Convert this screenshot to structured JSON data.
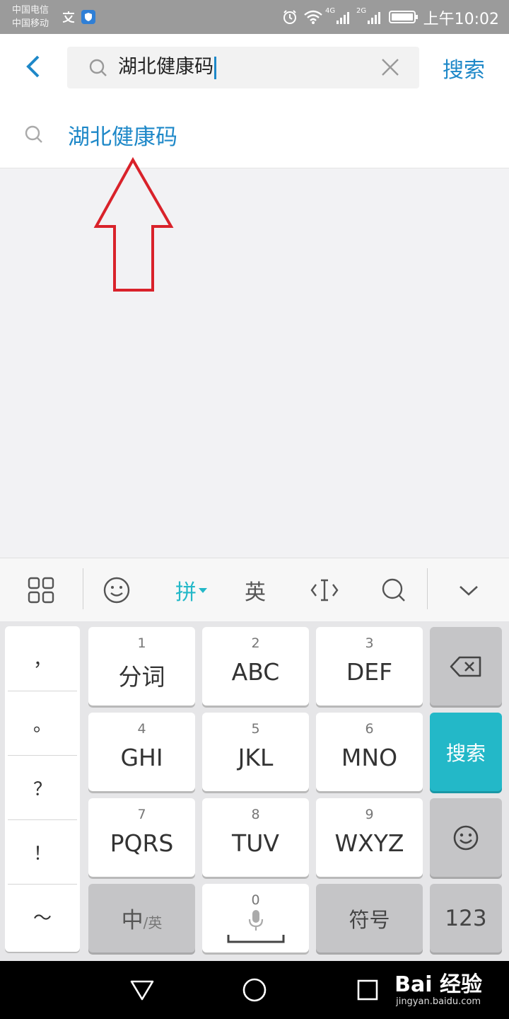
{
  "status_bar": {
    "carrier1": "中国电信",
    "carrier2": "中国移动",
    "badge1": "4G",
    "badge2": "2G",
    "time": "上午10:02"
  },
  "search": {
    "query": "湖北健康码",
    "search_button": "搜索"
  },
  "suggestions": [
    {
      "text": "湖北健康码"
    }
  ],
  "keyboard": {
    "toolbar": {
      "pinyin": "拼",
      "english": "英"
    },
    "punctuation": [
      "，",
      "。",
      "？",
      "！",
      "～"
    ],
    "keys": {
      "k1": {
        "num": "1",
        "label": "分词"
      },
      "k2": {
        "num": "2",
        "label": "ABC"
      },
      "k3": {
        "num": "3",
        "label": "DEF"
      },
      "k4": {
        "num": "4",
        "label": "GHI"
      },
      "k5": {
        "num": "5",
        "label": "JKL"
      },
      "k6": {
        "num": "6",
        "label": "MNO"
      },
      "k7": {
        "num": "7",
        "label": "PQRS"
      },
      "k8": {
        "num": "8",
        "label": "TUV"
      },
      "k9": {
        "num": "9",
        "label": "WXYZ"
      },
      "k0": {
        "num": "0"
      },
      "search": "搜索",
      "lang_main": "中",
      "lang_sub": "/英",
      "symbols": "符号",
      "numbers": "123"
    },
    "accent_color": "#23b8c8"
  },
  "watermark": {
    "logo": "Bai 经验",
    "url": "jingyan.baidu.com"
  },
  "colors": {
    "link_blue": "#1e88c8",
    "arrow_red": "#d9222a"
  }
}
